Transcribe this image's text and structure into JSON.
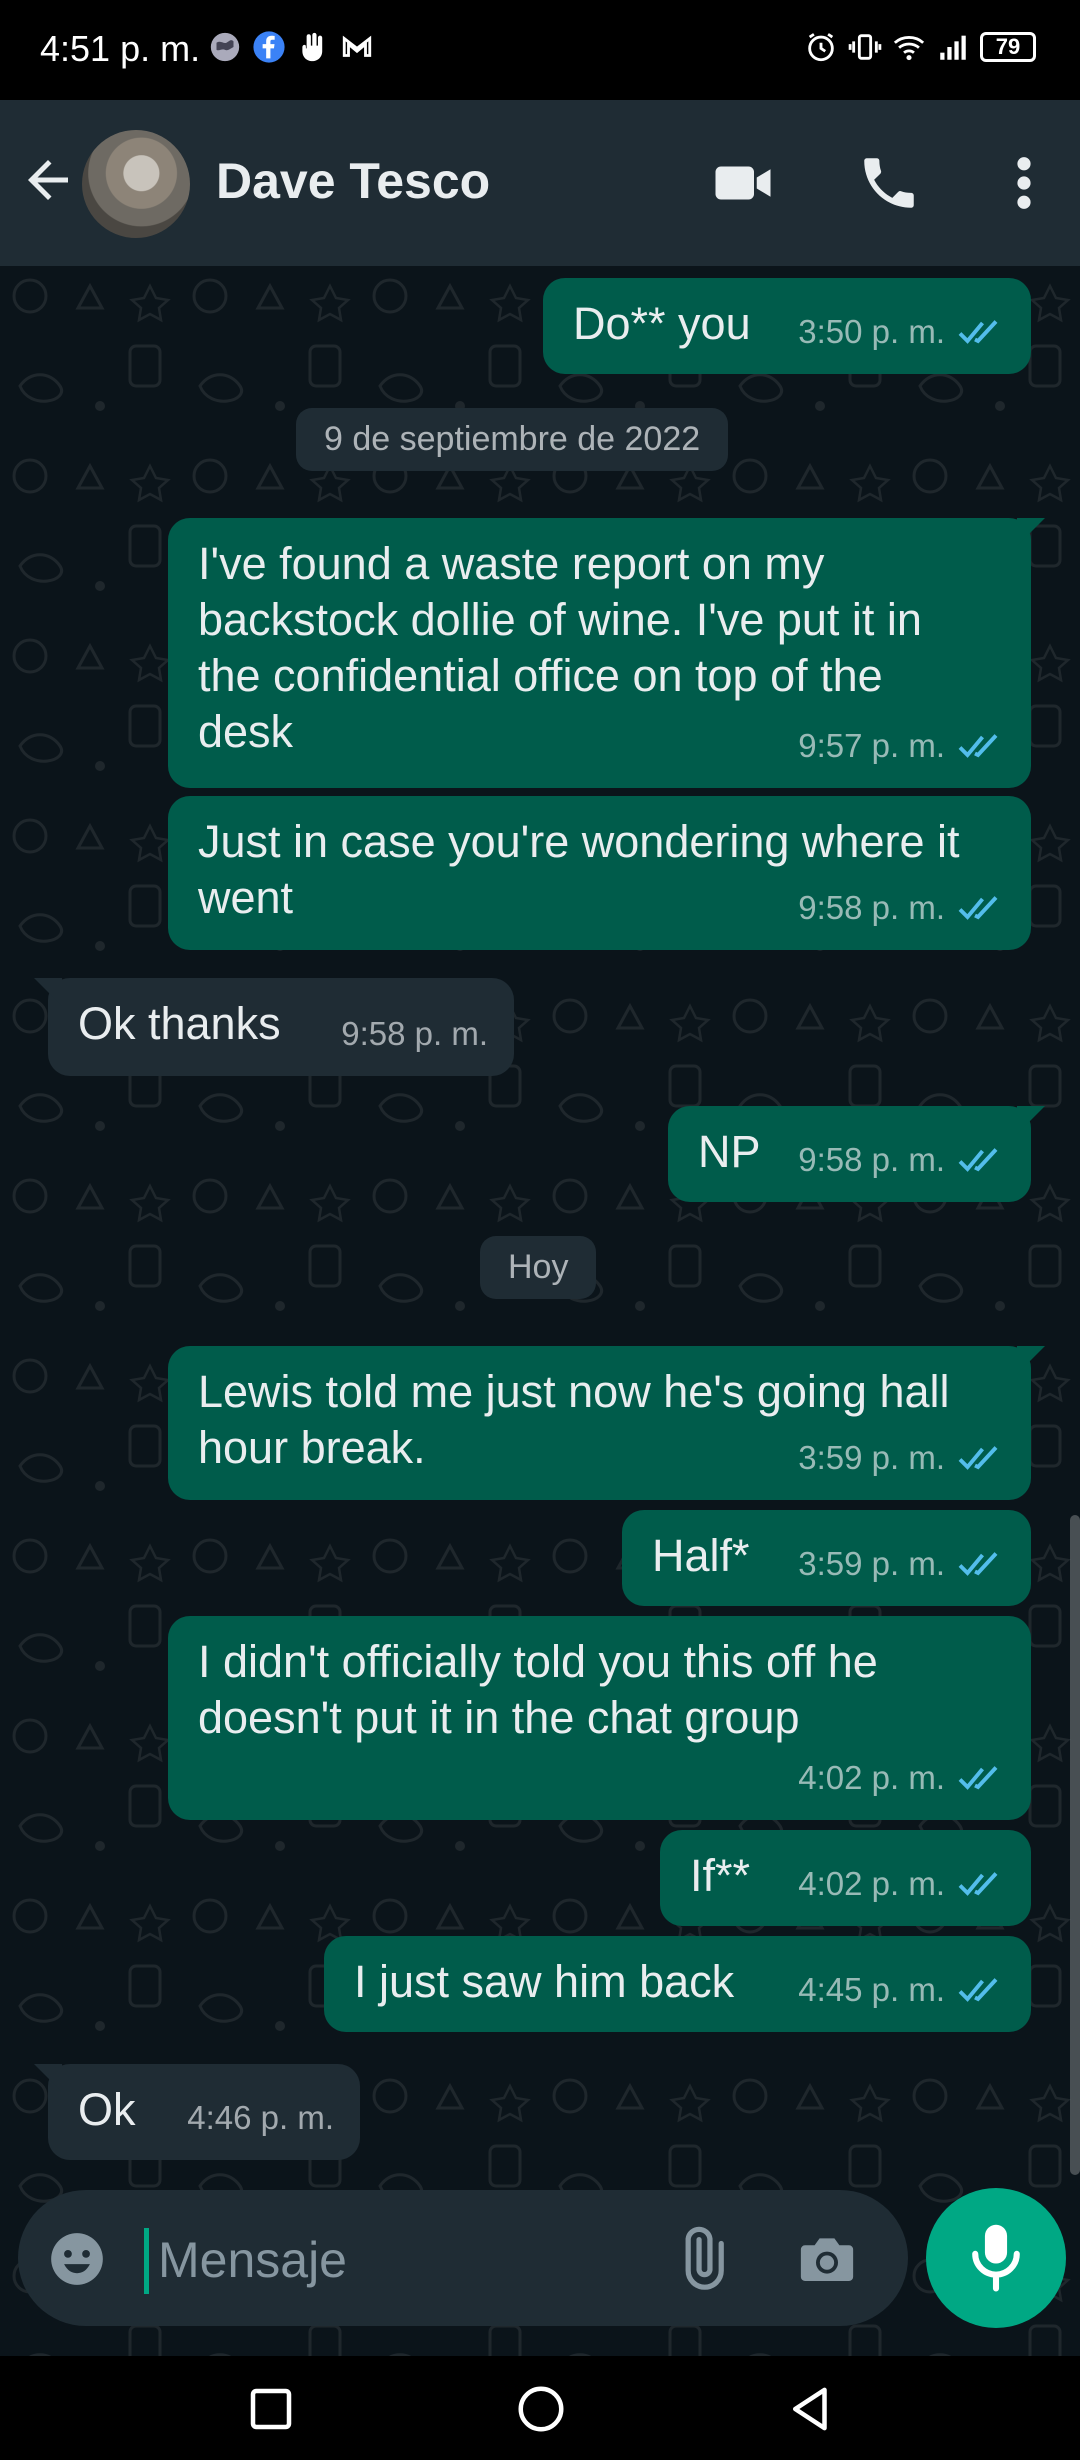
{
  "status_bar": {
    "time": "4:51 p. m.",
    "battery": "79",
    "icons": [
      "globe-icon",
      "facebook-icon",
      "hand-icon",
      "gmail-icon",
      "alarm-icon",
      "vibrate-icon",
      "wifi-icon",
      "signal-icon"
    ]
  },
  "header": {
    "contact_name": "Dave Tesco",
    "icons": [
      "back-arrow-icon",
      "video-call-icon",
      "phone-call-icon",
      "more-options-icon"
    ]
  },
  "chat": {
    "date_separators": {
      "first": "9 de septiembre de 2022",
      "second": "Hoy"
    },
    "messages": [
      {
        "direction": "out",
        "text": "Do** you",
        "time": "3:50 p. m.",
        "read": true
      },
      {
        "direction": "out",
        "text": "I've found a waste report on my backstock dollie of wine. I've put it in the confidential office on top of the desk",
        "time": "9:57 p. m.",
        "read": true
      },
      {
        "direction": "out",
        "text": "Just in case you're wondering where it went",
        "time": "9:58 p. m.",
        "read": true
      },
      {
        "direction": "in",
        "text": "Ok thanks",
        "time": "9:58 p. m."
      },
      {
        "direction": "out",
        "text": "NP",
        "time": "9:58 p. m.",
        "read": true
      },
      {
        "direction": "out",
        "text": "Lewis told me just now he's going hall hour break.",
        "time": "3:59 p. m.",
        "read": true
      },
      {
        "direction": "out",
        "text": "Half*",
        "time": "3:59 p. m.",
        "read": true
      },
      {
        "direction": "out",
        "text": "I didn't officially told you this off he doesn't put it in the chat group",
        "time": "4:02 p. m.",
        "read": true
      },
      {
        "direction": "out",
        "text": "If**",
        "time": "4:02 p. m.",
        "read": true
      },
      {
        "direction": "out",
        "text": "I just saw him back",
        "time": "4:45 p. m.",
        "read": true
      },
      {
        "direction": "in",
        "text": "Ok",
        "time": "4:46 p. m."
      }
    ]
  },
  "composer": {
    "placeholder": "Mensaje",
    "icons": [
      "emoji-icon",
      "attach-icon",
      "camera-icon",
      "microphone-icon"
    ]
  },
  "colors": {
    "outgoing_bubble": "#005c4b",
    "incoming_bubble": "#1f2c34",
    "header_bg": "#1f2c34",
    "chat_bg": "#0b141a",
    "accent": "#00a884",
    "read_ticks": "#53bdeb"
  }
}
